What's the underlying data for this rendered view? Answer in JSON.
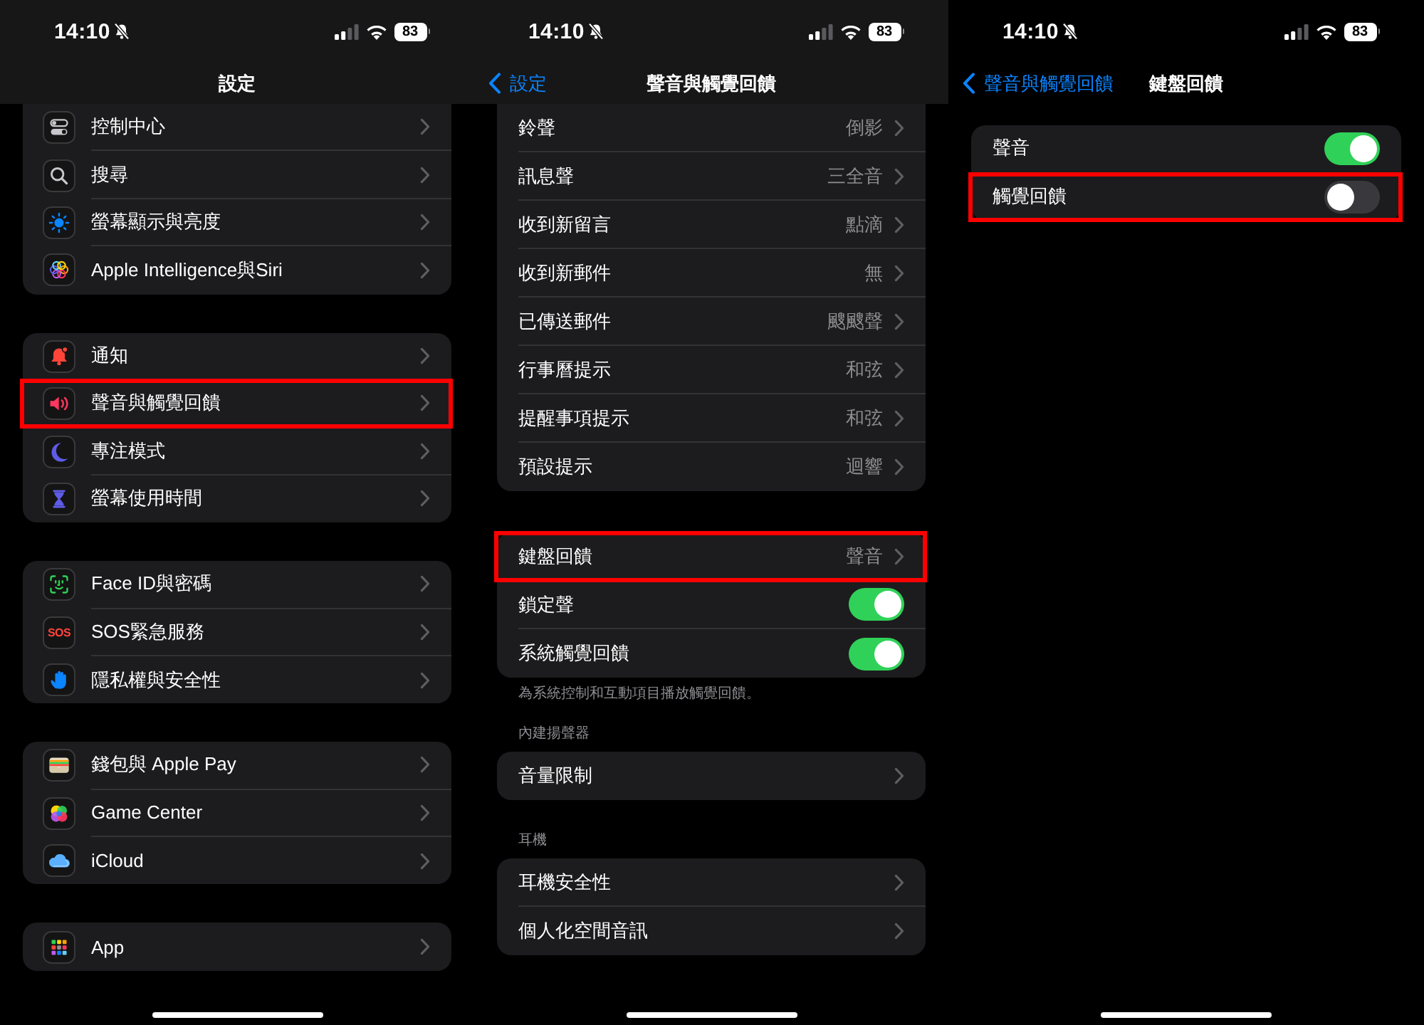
{
  "screens": [
    {
      "status_bar": {
        "time": "14:10",
        "battery": "83"
      },
      "nav": {
        "title": "設定",
        "scrolled": true
      },
      "sections": [
        {
          "rows": [
            {
              "label": "控制中心",
              "kind": "link",
              "highlighted": false
            },
            {
              "label": "搜尋",
              "kind": "link",
              "highlighted": false
            },
            {
              "label": "螢幕顯示與亮度",
              "kind": "link",
              "highlighted": false
            },
            {
              "label": "Apple Intelligence與Siri",
              "kind": "link",
              "highlighted": false
            }
          ]
        },
        {
          "rows": [
            {
              "label": "通知",
              "kind": "link",
              "highlighted": false
            },
            {
              "label": "聲音與觸覺回饋",
              "kind": "link",
              "highlighted": true
            },
            {
              "label": "專注模式",
              "kind": "link",
              "highlighted": false
            },
            {
              "label": "螢幕使用時間",
              "kind": "link",
              "highlighted": false
            }
          ]
        },
        {
          "rows": [
            {
              "label": "Face ID與密碼",
              "kind": "link",
              "highlighted": false
            },
            {
              "label": "SOS緊急服務",
              "icon_text": "SOS",
              "kind": "link",
              "highlighted": false
            },
            {
              "label": "隱私權與安全性",
              "kind": "link",
              "highlighted": false
            }
          ]
        },
        {
          "rows": [
            {
              "label": "錢包與 Apple Pay",
              "kind": "link",
              "highlighted": false
            },
            {
              "label": "Game Center",
              "kind": "link",
              "highlighted": false
            },
            {
              "label": "iCloud",
              "kind": "link",
              "highlighted": false
            }
          ]
        },
        {
          "rows": [
            {
              "label": "App",
              "kind": "link",
              "highlighted": false
            }
          ]
        }
      ]
    },
    {
      "status_bar": {
        "time": "14:10",
        "battery": "83"
      },
      "nav": {
        "back": "設定",
        "title": "聲音與觸覺回饋",
        "scrolled": true
      },
      "sections": [
        {
          "rows": [
            {
              "label": "鈴聲",
              "value": "倒影",
              "kind": "link",
              "highlighted": false
            },
            {
              "label": "訊息聲",
              "value": "三全音",
              "kind": "link",
              "highlighted": false
            },
            {
              "label": "收到新留言",
              "value": "點滴",
              "kind": "link",
              "highlighted": false
            },
            {
              "label": "收到新郵件",
              "value": "無",
              "kind": "link",
              "highlighted": false
            },
            {
              "label": "已傳送郵件",
              "value": "颼颼聲",
              "kind": "link",
              "highlighted": false
            },
            {
              "label": "行事曆提示",
              "value": "和弦",
              "kind": "link",
              "highlighted": false
            },
            {
              "label": "提醒事項提示",
              "value": "和弦",
              "kind": "link",
              "highlighted": false
            },
            {
              "label": "預設提示",
              "value": "迴響",
              "kind": "link",
              "highlighted": false
            }
          ]
        },
        {
          "rows": [
            {
              "label": "鍵盤回饋",
              "value": "聲音",
              "kind": "link",
              "highlighted": true
            },
            {
              "label": "鎖定聲",
              "kind": "toggle",
              "on": true,
              "highlighted": false
            },
            {
              "label": "系統觸覺回饋",
              "kind": "toggle",
              "on": true,
              "highlighted": false
            }
          ],
          "footer": "為系統控制和互動項目播放觸覺回饋。"
        },
        {
          "header": "內建揚聲器",
          "rows": [
            {
              "label": "音量限制",
              "kind": "link",
              "highlighted": false
            }
          ]
        },
        {
          "header": "耳機",
          "rows": [
            {
              "label": "耳機安全性",
              "kind": "link",
              "highlighted": false
            },
            {
              "label": "個人化空間音訊",
              "kind": "link",
              "highlighted": false
            }
          ]
        }
      ]
    },
    {
      "status_bar": {
        "time": "14:10",
        "battery": "83"
      },
      "nav": {
        "back": "聲音與觸覺回饋",
        "title": "鍵盤回饋",
        "scrolled": false
      },
      "sections": [
        {
          "rows": [
            {
              "label": "聲音",
              "kind": "toggle",
              "on": true,
              "highlighted": false
            },
            {
              "label": "觸覺回饋",
              "kind": "toggle",
              "on": false,
              "highlighted": true
            }
          ]
        }
      ]
    }
  ]
}
